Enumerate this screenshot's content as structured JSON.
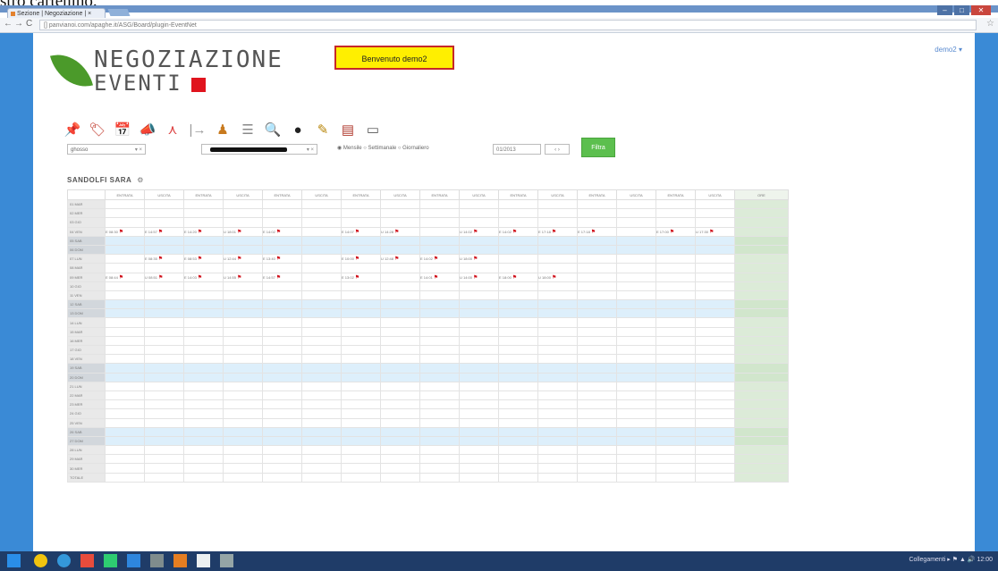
{
  "caption_text": "stro carteniho.",
  "browser": {
    "tab_title": "Sezione | Negoziazione | ×",
    "url": "[] panvianoi.com/apaghe.it/ASG/Board/plugin-EventNet",
    "star": "☆"
  },
  "app": {
    "logo_line1": "NEGOZIAZIONE",
    "logo_line2": "EVENTI",
    "welcome": "Benvenuto demo2",
    "user_menu": "demo2 ▾"
  },
  "toolbar_icons": [
    {
      "name": "pin-icon",
      "glyph": "📌",
      "color": "#2b6cc4"
    },
    {
      "name": "tag-icon",
      "glyph": "🏷",
      "color": "#c0392b"
    },
    {
      "name": "calendar-icon",
      "glyph": "📅",
      "color": "#c0392b"
    },
    {
      "name": "megaphone-icon",
      "glyph": "📣",
      "color": "#7f8c8d"
    },
    {
      "name": "pdf-icon",
      "glyph": "⋏",
      "color": "#d44"
    },
    {
      "name": "step-icon",
      "glyph": "|→",
      "color": "#999"
    },
    {
      "name": "person-icon",
      "glyph": "♟",
      "color": "#c87a1e"
    },
    {
      "name": "list-icon",
      "glyph": "☰",
      "color": "#888"
    },
    {
      "name": "search-icon",
      "glyph": "🔍",
      "color": "#3a6fc4"
    },
    {
      "name": "clock-icon",
      "glyph": "●",
      "color": "#222"
    },
    {
      "name": "pencil-icon",
      "glyph": "✎",
      "color": "#b8860b"
    },
    {
      "name": "report-icon",
      "glyph": "▤",
      "color": "#b03a2e"
    },
    {
      "name": "print-icon",
      "glyph": "▭",
      "color": "#555"
    }
  ],
  "filters": {
    "select1_value": "ghosso",
    "select1_arrow": "▾ ×",
    "select2_arrow": "▾ ×",
    "radios": "◉ Mensile  ○ Settimanale  ○ Giornaliero",
    "date_value": "01/2013",
    "stepper": "‹ ›",
    "go_button": "Filtra"
  },
  "section": {
    "title": "SANDOLFI SARA",
    "gear": "⚙"
  },
  "grid": {
    "header_labels": [
      "",
      "ENTRATA",
      "USCITA",
      "ENTRATA",
      "USCITA",
      "ENTRATA",
      "USCITA",
      "ENTRATA",
      "USCITA",
      "ENTRATA",
      "USCITA",
      "ENTRATA",
      "USCITA",
      "ENTRATA",
      "USCITA",
      "ENTRATA",
      "USCITA",
      "ORE"
    ],
    "rows": [
      {
        "label": "01 MAR",
        "hl": false,
        "cells": []
      },
      {
        "label": "02 MER",
        "hl": false,
        "cells": []
      },
      {
        "label": "03 GIO",
        "hl": false,
        "cells": []
      },
      {
        "label": "04 VEN",
        "hl": false,
        "cells": [
          "E 08:30",
          "E 14:57",
          "E 14:20",
          "U 18:01",
          "E 14:02",
          "",
          "E 14:07",
          "U 14:28",
          "",
          "U 14:02",
          "E 14:02",
          "E 17:18",
          "E 17:18",
          "",
          "E 17:00",
          "U 17:30"
        ]
      },
      {
        "label": "05 SAB",
        "hl": true,
        "cells": []
      },
      {
        "label": "06 DOM",
        "hl": true,
        "cells": []
      },
      {
        "label": "07 LUN",
        "hl": false,
        "cells": [
          "",
          "E 08:35",
          "E 08:53",
          "U 12:44",
          "E 13:40",
          "",
          "E 10:00",
          "U 12:48",
          "E 14:02",
          "U 18:00",
          "",
          "",
          "",
          "",
          "",
          ""
        ]
      },
      {
        "label": "08 MAR",
        "hl": false,
        "cells": []
      },
      {
        "label": "09 MER",
        "hl": false,
        "cells": [
          "E 08:44",
          "U 08:51",
          "E 14:03",
          "U 14:55",
          "E 14:57",
          "",
          "E 13:02",
          "",
          "E 14:01",
          "U 14:00",
          "E 18:00",
          "U 18:00",
          "",
          "",
          "",
          ""
        ]
      },
      {
        "label": "10 GIO",
        "hl": false,
        "cells": []
      },
      {
        "label": "11 VEN",
        "hl": false,
        "cells": []
      },
      {
        "label": "12 SAB",
        "hl": true,
        "cells": []
      },
      {
        "label": "13 DOM",
        "hl": true,
        "cells": []
      },
      {
        "label": "14 LUN",
        "hl": false,
        "cells": []
      },
      {
        "label": "15 MAR",
        "hl": false,
        "cells": []
      },
      {
        "label": "16 MER",
        "hl": false,
        "cells": []
      },
      {
        "label": "17 GIO",
        "hl": false,
        "cells": []
      },
      {
        "label": "18 VEN",
        "hl": false,
        "cells": []
      },
      {
        "label": "19 SAB",
        "hl": true,
        "cells": []
      },
      {
        "label": "20 DOM",
        "hl": true,
        "cells": []
      },
      {
        "label": "21 LUN",
        "hl": false,
        "cells": []
      },
      {
        "label": "22 MAR",
        "hl": false,
        "cells": []
      },
      {
        "label": "23 MER",
        "hl": false,
        "cells": []
      },
      {
        "label": "24 GIO",
        "hl": false,
        "cells": []
      },
      {
        "label": "25 VEN",
        "hl": false,
        "cells": []
      },
      {
        "label": "26 SAB",
        "hl": true,
        "cells": []
      },
      {
        "label": "27 DOM",
        "hl": true,
        "cells": []
      },
      {
        "label": "28 LUN",
        "hl": false,
        "cells": []
      },
      {
        "label": "29 MAR",
        "hl": false,
        "cells": []
      },
      {
        "label": "30 MER",
        "hl": false,
        "cells": []
      },
      {
        "label": "TOTALE",
        "hl": false,
        "cells": []
      }
    ]
  },
  "taskbar": {
    "tray_text": "Collegamenti ▸  ⚑ ▲ 🔊  12:00"
  }
}
